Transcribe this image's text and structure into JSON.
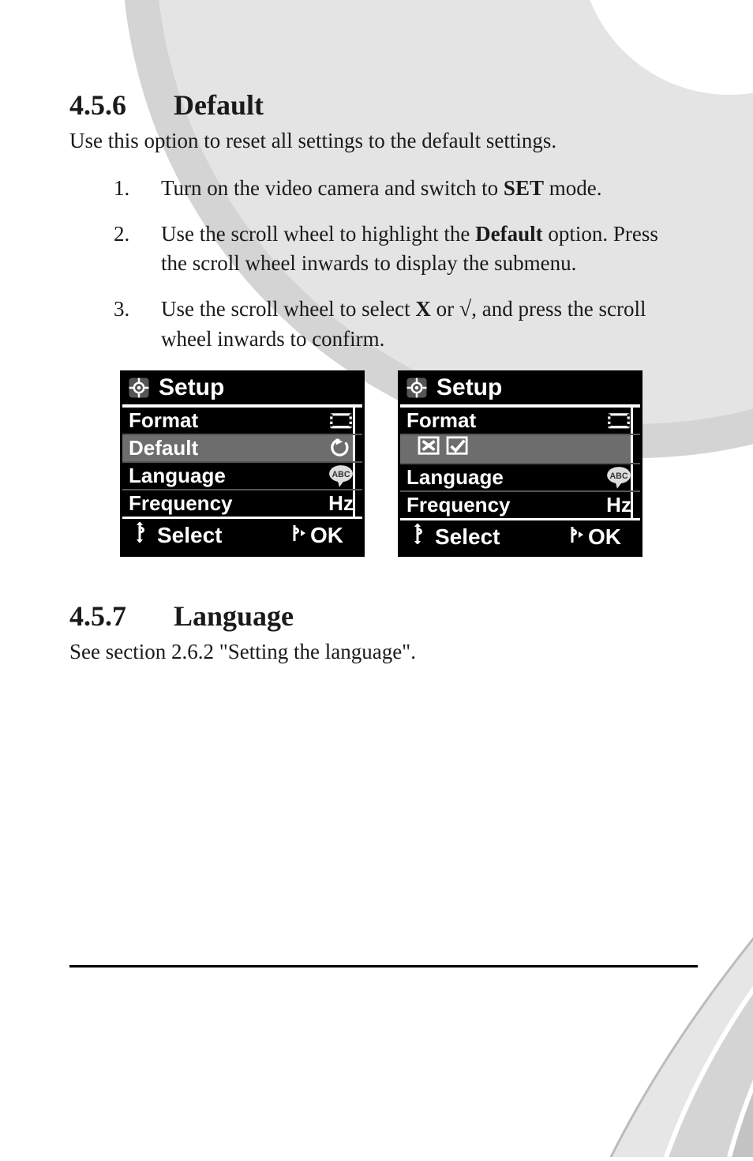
{
  "sections": {
    "default": {
      "num": "4.5.6",
      "title": "Default"
    },
    "language": {
      "num": "4.5.7",
      "title": "Language"
    }
  },
  "default_intro": "Use this option to reset all settings to the default settings.",
  "steps": [
    {
      "pre": "Turn on the video camera and switch to ",
      "bold": "SET",
      "post": " mode."
    },
    {
      "pre": "Use the scroll wheel to highlight the ",
      "bold": "Default",
      "post": " option. Press the scroll wheel inwards to display the submenu."
    },
    {
      "pre": "Use the scroll wheel to select ",
      "bold": "X",
      "post_pre": " or ",
      "sqrt": "√",
      "post": ", and press the scroll wheel inwards to confirm."
    }
  ],
  "screens": {
    "left": {
      "title": "Setup",
      "rows": [
        {
          "label": "Format",
          "icon": "film-icon",
          "highlight": false
        },
        {
          "label": "Default",
          "icon": "revert-icon",
          "highlight": true
        },
        {
          "label": "Language",
          "icon": "abc-icon",
          "highlight": false
        },
        {
          "label": "Frequency",
          "icon_text": "Hz",
          "highlight": false
        }
      ],
      "footer": {
        "select": "Select",
        "ok": "OK"
      }
    },
    "right": {
      "title": "Setup",
      "rows": [
        {
          "label": "Format",
          "icon": "film-icon",
          "highlight": false
        },
        {
          "xcheck": true,
          "highlight": true
        },
        {
          "label": "Language",
          "icon": "abc-icon",
          "highlight": false
        },
        {
          "label": "Frequency",
          "icon_text": "Hz",
          "highlight": false
        }
      ],
      "footer": {
        "select": "Select",
        "ok": "OK"
      }
    }
  },
  "language_body": "See section 2.6.2 \"Setting the language\"."
}
